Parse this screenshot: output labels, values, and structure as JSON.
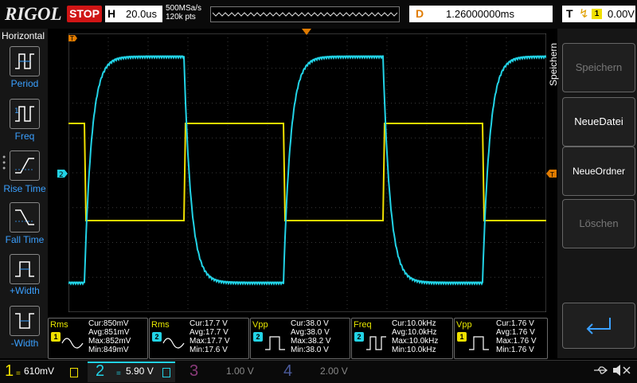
{
  "top": {
    "brand": "RIGOL",
    "run_status": "STOP",
    "horizontal_label": "H",
    "timebase": "20.0us",
    "sample_rate": "500MSa/s",
    "points": "120k pts",
    "delay_label": "D",
    "delay_value": "1.26000000ms",
    "trigger_label": "T",
    "trigger_channel": "1",
    "trigger_level": "0.00V"
  },
  "left_panel": {
    "title": "Horizontal",
    "items": [
      {
        "label": "Period",
        "icon": "period-icon"
      },
      {
        "label": "Freq",
        "icon": "freq-icon"
      },
      {
        "label": "Rise Time",
        "icon": "rise-time-icon"
      },
      {
        "label": "Fall Time",
        "icon": "fall-time-icon"
      },
      {
        "label": "+Width",
        "icon": "pos-width-icon"
      },
      {
        "label": "-Width",
        "icon": "neg-width-icon"
      }
    ]
  },
  "right_panel": {
    "title": "Speichern",
    "buttons": [
      {
        "label": "Speichern",
        "enabled": false
      },
      {
        "label": "NeueDatei",
        "enabled": true
      },
      {
        "label": "NeueOrdner",
        "enabled": true
      },
      {
        "label": "Löschen",
        "enabled": false
      }
    ]
  },
  "markers": {
    "ch1_marker": "1",
    "ch2_marker": "2",
    "trigger_pos_marker": "T"
  },
  "measurements": [
    {
      "type": "Rms",
      "channel": "1",
      "cur": "Cur:850mV",
      "avg": "Avg:851mV",
      "max": "Max:852mV",
      "min": "Min:849mV",
      "color": "#f0e000"
    },
    {
      "type": "Rms",
      "channel": "2",
      "cur": "Cur:17.7 V",
      "avg": "Avg:17.7 V",
      "max": "Max:17.7 V",
      "min": "Min:17.6 V",
      "color": "#22d3e6"
    },
    {
      "type": "Vpp",
      "channel": "2",
      "cur": "Cur:38.0 V",
      "avg": "Avg:38.0 V",
      "max": "Max:38.2 V",
      "min": "Min:38.0 V",
      "color": "#22d3e6"
    },
    {
      "type": "Freq",
      "channel": "2",
      "cur": "Cur:10.0kHz",
      "avg": "Avg:10.0kHz",
      "max": "Max:10.0kHz",
      "min": "Min:10.0kHz",
      "color": "#22d3e6"
    },
    {
      "type": "Vpp",
      "channel": "1",
      "cur": "Cur:1.76 V",
      "avg": "Avg:1.76 V",
      "max": "Max:1.76 V",
      "min": "Min:1.76 V",
      "color": "#f0e000"
    }
  ],
  "channels": [
    {
      "num": "1",
      "scale": "610mV",
      "color": "#f0e000",
      "active": true
    },
    {
      "num": "2",
      "scale": "5.90 V",
      "color": "#22d3e6",
      "active": true
    },
    {
      "num": "3",
      "scale": "1.00 V",
      "color": "#8a3a7a",
      "active": false
    },
    {
      "num": "4",
      "scale": "2.00 V",
      "color": "#4a5a9a",
      "active": false
    }
  ],
  "colors": {
    "ch1": "#f0e000",
    "ch2": "#22d3e6",
    "accent": "#e07b00",
    "menu_blue": "#3aa0ff"
  }
}
